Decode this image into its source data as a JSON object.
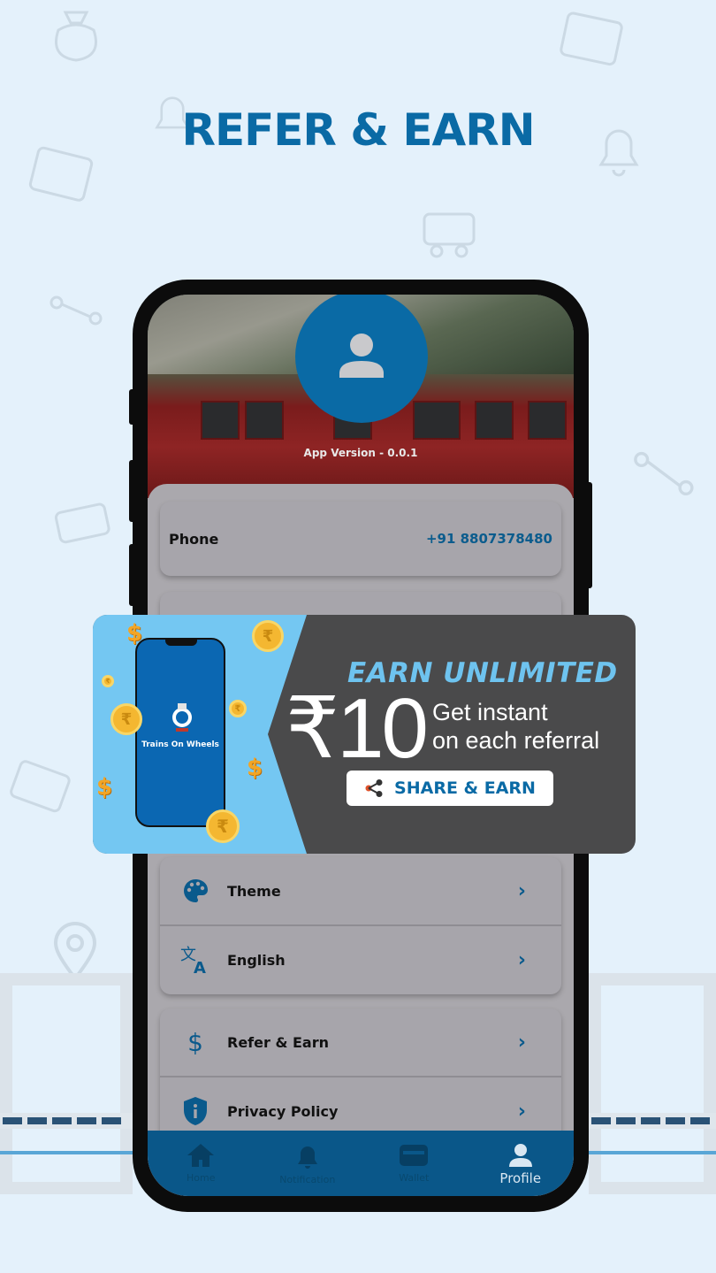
{
  "headline": "REFER & EARN",
  "profile": {
    "app_version": "App Version - 0.0.1",
    "phone_label": "Phone",
    "phone_value": "+91 8807378480"
  },
  "banner": {
    "title": "EARN UNLIMITED",
    "amount": "₹10",
    "line1": "Get instant",
    "line2": "on each referral",
    "share_label": "SHARE & EARN",
    "app_brand": "Trains On Wheels"
  },
  "menu": [
    {
      "label": "Theme",
      "icon": "palette-icon"
    },
    {
      "label": "English",
      "icon": "translate-icon"
    },
    {
      "label": "Refer & Earn",
      "icon": "dollar-icon"
    },
    {
      "label": "Privacy Policy",
      "icon": "shield-info-icon"
    }
  ],
  "nav": [
    {
      "label": "Home",
      "icon": "home-icon",
      "active": false
    },
    {
      "label": "Notification",
      "icon": "bell-icon",
      "active": false
    },
    {
      "label": "Wallet",
      "icon": "wallet-icon",
      "active": false
    },
    {
      "label": "Profile",
      "icon": "person-icon",
      "active": true
    }
  ],
  "colors": {
    "brand": "#0a6aa5",
    "nav": "#0a5789",
    "banner_dark": "#4a4a4b",
    "banner_light": "#74c7f2",
    "coin": "#f4b731"
  }
}
